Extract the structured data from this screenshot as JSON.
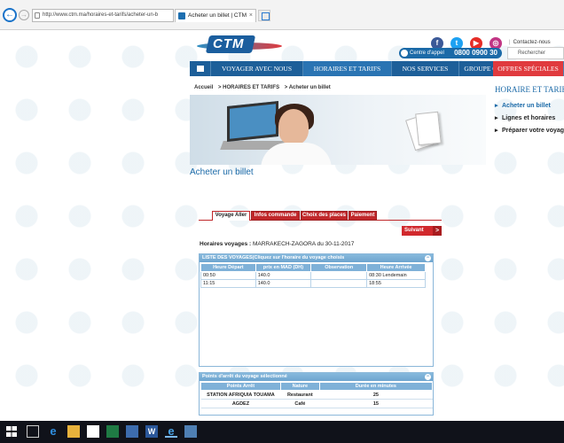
{
  "browser": {
    "url": "http://www.ctm.ma/horaires-et-tarifs/acheter-un-b",
    "tab_title": "Acheter un billet | CTM",
    "tab_close": "×",
    "back": "←",
    "forward": "→"
  },
  "header": {
    "logo_text": "CTM",
    "social": [
      "f",
      "t",
      "▶",
      "◎"
    ],
    "contact_label": "Contactez-nous",
    "call_label": "Centre d'appel",
    "call_number": "0800 0900 30",
    "search_placeholder": "Rechercher"
  },
  "menu": {
    "items": [
      "VOYAGER AVEC NOUS",
      "HORAIRES ET TARIFS",
      "NOS SERVICES",
      "GROUPE CTM",
      "OFFRES SPÉCIALES"
    ]
  },
  "breadcrumb": [
    "Accueil",
    "> HORAIRES ET TARIFS",
    "> Acheter un billet"
  ],
  "page_title": "Acheter un billet",
  "sidebar": {
    "title": "HORAIRE ET TARIFS",
    "items": [
      "Acheter un billet",
      "Lignes et horaires",
      "Préparer votre voyage"
    ]
  },
  "steps": [
    "Voyage Aller",
    "Infos commande",
    "Choix des places",
    "Paiement"
  ],
  "next_button": "Suivant",
  "next_arrow": ">",
  "horaires": {
    "label": "Horaires voyages :",
    "route": "MARRAKECH-ZAGORA du 30-11-2017"
  },
  "trips_panel": {
    "title": "LISTE DES VOYAGES(Cliquez sur l'horaire du voyage choisis",
    "collapse": "−",
    "columns": [
      "Heure Départ",
      "prix en MAD (DH)",
      "Observation",
      "Heure Arrivée"
    ],
    "rows": [
      [
        "00:50",
        "140.0",
        "",
        "08:30  Lendemain"
      ],
      [
        "11:15",
        "140.0",
        "",
        "18:55"
      ]
    ]
  },
  "stops_panel": {
    "title": "Points d'arrêt du voyage sélectionné",
    "collapse": "−",
    "columns": [
      "Points Arrêt",
      "Nature",
      "Durée en minutes"
    ],
    "rows": [
      [
        "STATION AFRIQUIA TOUAMA",
        "Restaurant",
        "25"
      ],
      [
        "AGDEZ",
        "Café",
        "15"
      ]
    ]
  },
  "taskbar": {
    "word_label": "W",
    "edge_label": "e",
    "ie_label": "e"
  }
}
